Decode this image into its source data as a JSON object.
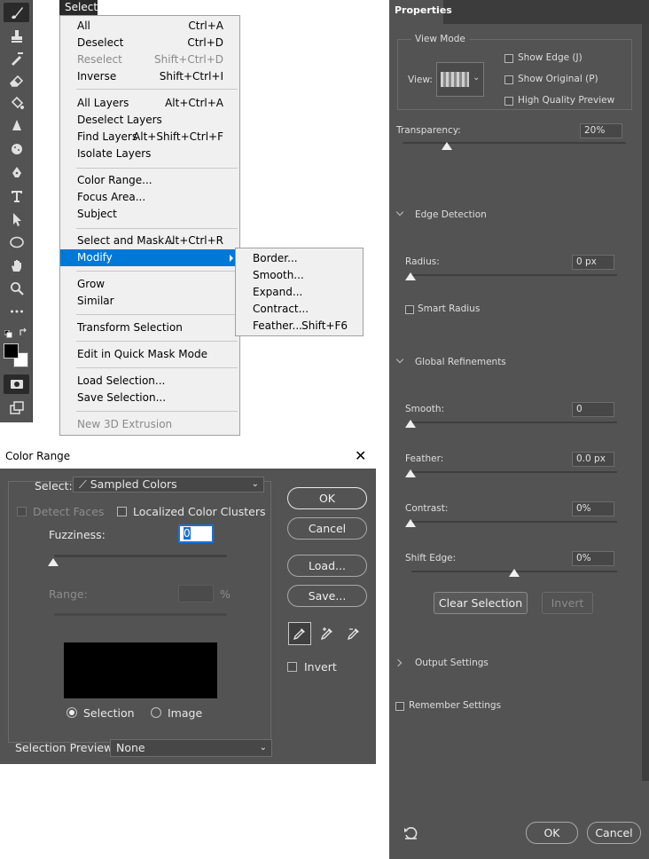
{
  "menu_bar": {
    "active_menu": "Select"
  },
  "select_menu": {
    "items": [
      {
        "label": "All",
        "shortcut": "Ctrl+A"
      },
      {
        "label": "Deselect",
        "shortcut": "Ctrl+D"
      },
      {
        "label": "Reselect",
        "shortcut": "Shift+Ctrl+D"
      },
      {
        "label": "Inverse",
        "shortcut": "Shift+Ctrl+I"
      },
      {
        "label": "All Layers",
        "shortcut": "Alt+Ctrl+A"
      },
      {
        "label": "Deselect Layers",
        "shortcut": ""
      },
      {
        "label": "Find Layers",
        "shortcut": "Alt+Shift+Ctrl+F"
      },
      {
        "label": "Isolate Layers",
        "shortcut": ""
      },
      {
        "label": "Color Range...",
        "shortcut": ""
      },
      {
        "label": "Focus Area...",
        "shortcut": ""
      },
      {
        "label": "Subject",
        "shortcut": ""
      },
      {
        "label": "Select and Mask...",
        "shortcut": "Alt+Ctrl+R"
      },
      {
        "label": "Modify",
        "shortcut": ""
      },
      {
        "label": "Grow",
        "shortcut": ""
      },
      {
        "label": "Similar",
        "shortcut": ""
      },
      {
        "label": "Transform Selection",
        "shortcut": ""
      },
      {
        "label": "Edit in Quick Mask Mode",
        "shortcut": ""
      },
      {
        "label": "Load Selection...",
        "shortcut": ""
      },
      {
        "label": "Save Selection...",
        "shortcut": ""
      },
      {
        "label": "New 3D Extrusion",
        "shortcut": ""
      }
    ],
    "highlighted": "Modify"
  },
  "modify_submenu": {
    "items": [
      {
        "label": "Border...",
        "shortcut": ""
      },
      {
        "label": "Smooth...",
        "shortcut": ""
      },
      {
        "label": "Expand...",
        "shortcut": ""
      },
      {
        "label": "Contract...",
        "shortcut": ""
      },
      {
        "label": "Feather...",
        "shortcut": "Shift+F6"
      }
    ]
  },
  "color_range": {
    "title": "Color Range",
    "select_label": "Select:",
    "select_value": "Sampled Colors",
    "detect_faces_label": "Detect Faces",
    "localized_label": "Localized Color Clusters",
    "fuzziness_label": "Fuzziness:",
    "fuzziness_value": "0",
    "range_label": "Range:",
    "range_unit": "%",
    "ok_label": "OK",
    "cancel_label": "Cancel",
    "load_label": "Load...",
    "save_label": "Save...",
    "invert_label": "Invert",
    "selection_radio_label": "Selection",
    "image_radio_label": "Image",
    "preview_label": "Selection Preview:",
    "preview_value": "None"
  },
  "properties": {
    "tab_label": "Properties",
    "view_mode_label": "View Mode",
    "view_label": "View:",
    "show_edge_label": "Show Edge (J)",
    "show_original_label": "Show Original (P)",
    "hq_preview_label": "High Quality Preview",
    "transparency_label": "Transparency:",
    "transparency_value": "20%",
    "transparency_level": 0.2,
    "edge_detection_label": "Edge Detection",
    "radius_label": "Radius:",
    "radius_value": "0 px",
    "smart_radius_label": "Smart Radius",
    "global_refinements_label": "Global Refinements",
    "smooth_label": "Smooth:",
    "smooth_value": "0",
    "feather_label": "Feather:",
    "feather_value": "0.0 px",
    "contrast_label": "Contrast:",
    "contrast_value": "0%",
    "shift_edge_label": "Shift Edge:",
    "shift_edge_value": "0%",
    "clear_selection_label": "Clear Selection",
    "invert_label": "Invert",
    "output_settings_label": "Output Settings",
    "remember_settings_label": "Remember Settings",
    "ok_label": "OK",
    "cancel_label": "Cancel"
  },
  "colors": {
    "panel_bg": "#535353",
    "menu_bg": "#f0f0f0",
    "menu_highlight": "#0078d7",
    "focus_blue": "#1d6fd6"
  }
}
